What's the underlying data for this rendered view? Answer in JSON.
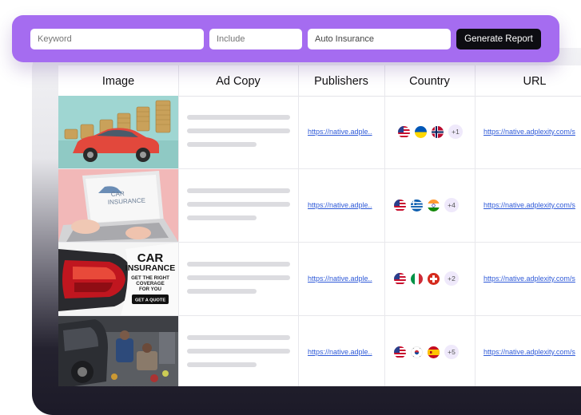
{
  "search": {
    "keyword_placeholder": "Keyword",
    "include_placeholder": "Include",
    "query_value": "Auto Insurance",
    "generate_label": "Generate Report"
  },
  "table": {
    "columns": [
      "Image",
      "Ad Copy",
      "Publishers",
      "Country",
      "URL"
    ],
    "rows": [
      {
        "publisher": "https://native.adple..",
        "flags": [
          "us-flag",
          "ua-flag",
          "no-flag"
        ],
        "more": "+1",
        "url": "https://native.adplexity.com/s"
      },
      {
        "publisher": "https://native.adple..",
        "flags": [
          "us-flag",
          "gr-flag",
          "in-flag"
        ],
        "more": "+4",
        "url": "https://native.adplexity.com/s"
      },
      {
        "publisher": "https://native.adple..",
        "flags": [
          "us-flag",
          "it-flag",
          "ch-flag"
        ],
        "more": "+2",
        "url": "https://native.adplexity.com/s"
      },
      {
        "publisher": "https://native.adple..",
        "flags": [
          "us-flag",
          "kr-flag",
          "es-flag"
        ],
        "more": "+5",
        "url": "https://native.adplexity.com/s"
      }
    ]
  },
  "ads": {
    "laptop_screen_line1": "CAR",
    "laptop_screen_line2": "INSURANCE",
    "banner_line1": "CAR",
    "banner_line2": "INSURANCE",
    "banner_line3": "GET THE RIGHT",
    "banner_line4": "COVERAGE",
    "banner_line5": "FOR YOU",
    "banner_cta": "GET A QUOTE"
  },
  "colors": {
    "accent_purple": "#a56cf0",
    "button_black": "#0d0d12",
    "link_blue": "#2f5ad8",
    "placeholder_gray": "#dcdce0"
  }
}
